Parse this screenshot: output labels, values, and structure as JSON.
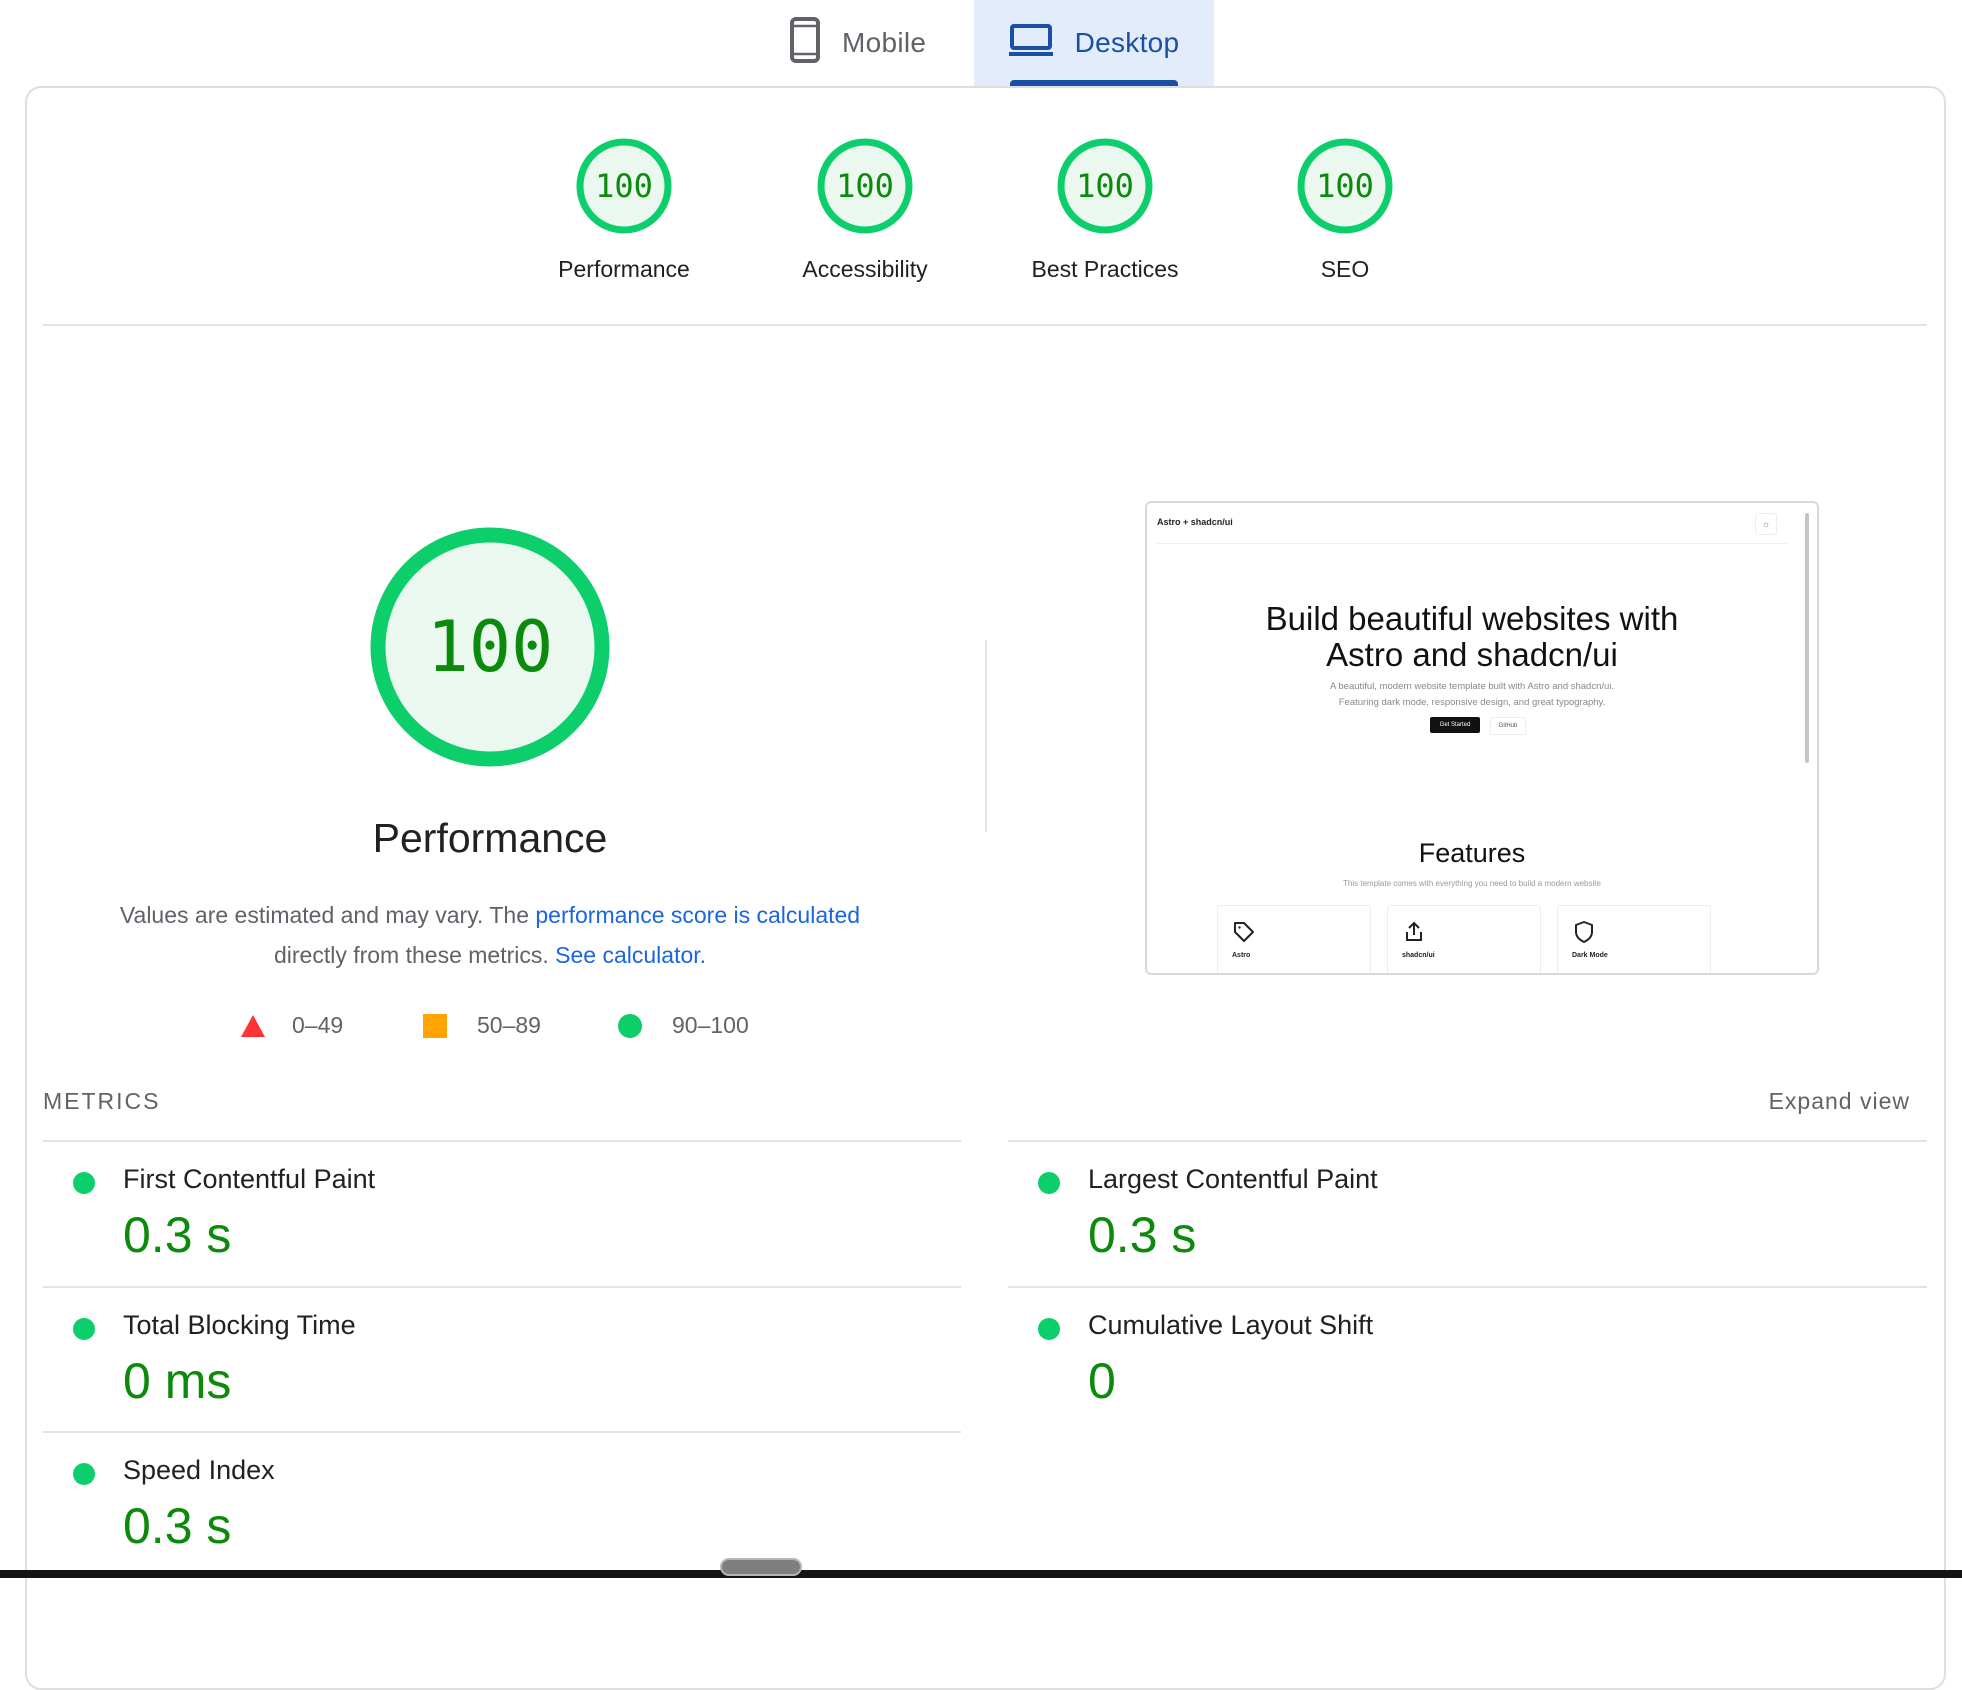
{
  "tabs": [
    {
      "label": "Mobile",
      "icon": "smartphone-icon",
      "selected": false
    },
    {
      "label": "Desktop",
      "icon": "laptop-icon",
      "selected": true
    }
  ],
  "colors": {
    "pass": "#0cce6b",
    "pass_text": "#0c8a0c",
    "pass_fill": "#eaf8f0",
    "average": "#ffa400",
    "fail": "#ff3333",
    "link": "#1a66e0",
    "tab_selected": "#1a4fa3"
  },
  "categories": [
    {
      "label": "Performance",
      "score": "100",
      "score_pct": 100
    },
    {
      "label": "Accessibility",
      "score": "100",
      "score_pct": 100
    },
    {
      "label": "Best Practices",
      "score": "100",
      "score_pct": 100
    },
    {
      "label": "SEO",
      "score": "100",
      "score_pct": 100
    }
  ],
  "performance": {
    "score": "100",
    "score_pct": 100,
    "title": "Performance",
    "desc_prefix": "Values are estimated and may vary. The ",
    "desc_link1": "performance score is calculated",
    "desc_middle": " directly from these metrics. ",
    "desc_link2": "See calculator.",
    "legend": [
      {
        "shape": "triangle",
        "range": "0–49"
      },
      {
        "shape": "square",
        "range": "50–89"
      },
      {
        "shape": "circle",
        "range": "90–100"
      }
    ]
  },
  "thumbnail": {
    "site_name": "Astro + shadcn/ui",
    "gear": "☼",
    "heading_line1": "Build beautiful websites with",
    "heading_line2": "Astro and shadcn/ui",
    "sub_line1": "A beautiful, modern website template built with Astro and shadcn/ui.",
    "sub_line2": "Featuring dark mode, responsive design, and great typography.",
    "btn_primary": "Get Started",
    "btn_secondary": "GitHub",
    "features_title": "Features",
    "features_sub": "This template comes with everything you need to build a modern website",
    "cards": [
      {
        "label": "Astro",
        "icon": "tag-icon"
      },
      {
        "label": "shadcn/ui",
        "icon": "share-icon"
      },
      {
        "label": "Dark Mode",
        "icon": "shield-icon"
      }
    ]
  },
  "metrics": {
    "title": "METRICS",
    "expand_label": "Expand view",
    "items": [
      {
        "name": "First Contentful Paint",
        "value": "0.3 s",
        "status": "pass"
      },
      {
        "name": "Largest Contentful Paint",
        "value": "0.3 s",
        "status": "pass"
      },
      {
        "name": "Total Blocking Time",
        "value": "0 ms",
        "status": "pass"
      },
      {
        "name": "Cumulative Layout Shift",
        "value": "0",
        "status": "pass"
      },
      {
        "name": "Speed Index",
        "value": "0.3 s",
        "status": "pass"
      }
    ]
  }
}
